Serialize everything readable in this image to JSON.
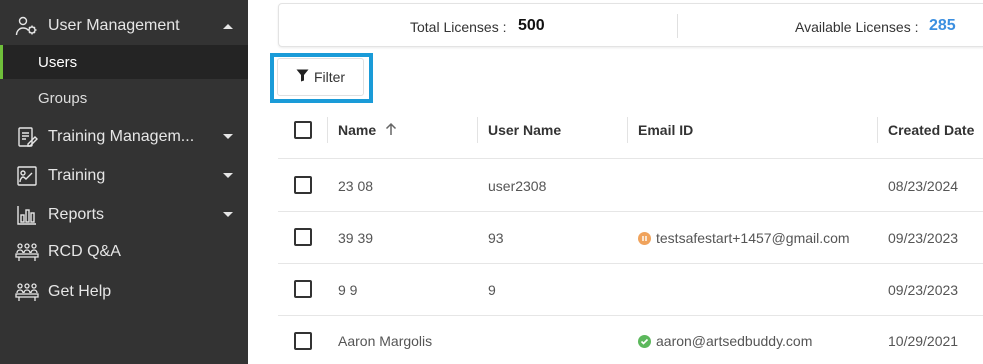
{
  "sidebar": {
    "user_management": "User Management",
    "users": "Users",
    "groups": "Groups",
    "training_management": "Training Managem...",
    "training": "Training",
    "reports": "Reports",
    "rcd_qa": "RCD Q&A",
    "get_help": "Get Help"
  },
  "licenses": {
    "total_label": "Total Licenses :",
    "total_value": "500",
    "available_label": "Available Licenses :",
    "available_value": "285",
    "available_color": "#3b8fe0"
  },
  "filter": {
    "label": "Filter"
  },
  "table": {
    "headers": {
      "name": "Name",
      "username": "User Name",
      "email": "Email ID",
      "created": "Created Date"
    },
    "rows": [
      {
        "name": "23 08",
        "username": "user2308",
        "email": "",
        "email_status": "",
        "created": "08/23/2024"
      },
      {
        "name": "39 39",
        "username": "93",
        "email": "testsafestart+1457@gmail.com",
        "email_status": "pending",
        "created": "09/23/2023"
      },
      {
        "name": "9 9",
        "username": "9",
        "email": "",
        "email_status": "",
        "created": "09/23/2023"
      },
      {
        "name": "Aaron Margolis",
        "username": "",
        "email": "aaron@artsedbuddy.com",
        "email_status": "verified",
        "created": "10/29/2021"
      }
    ]
  },
  "colors": {
    "sidebar_bg": "#333333",
    "active_accent": "#6fbf3a",
    "highlight": "#1a9bd8",
    "pending": "#f0a35c",
    "verified": "#5cb85c"
  }
}
